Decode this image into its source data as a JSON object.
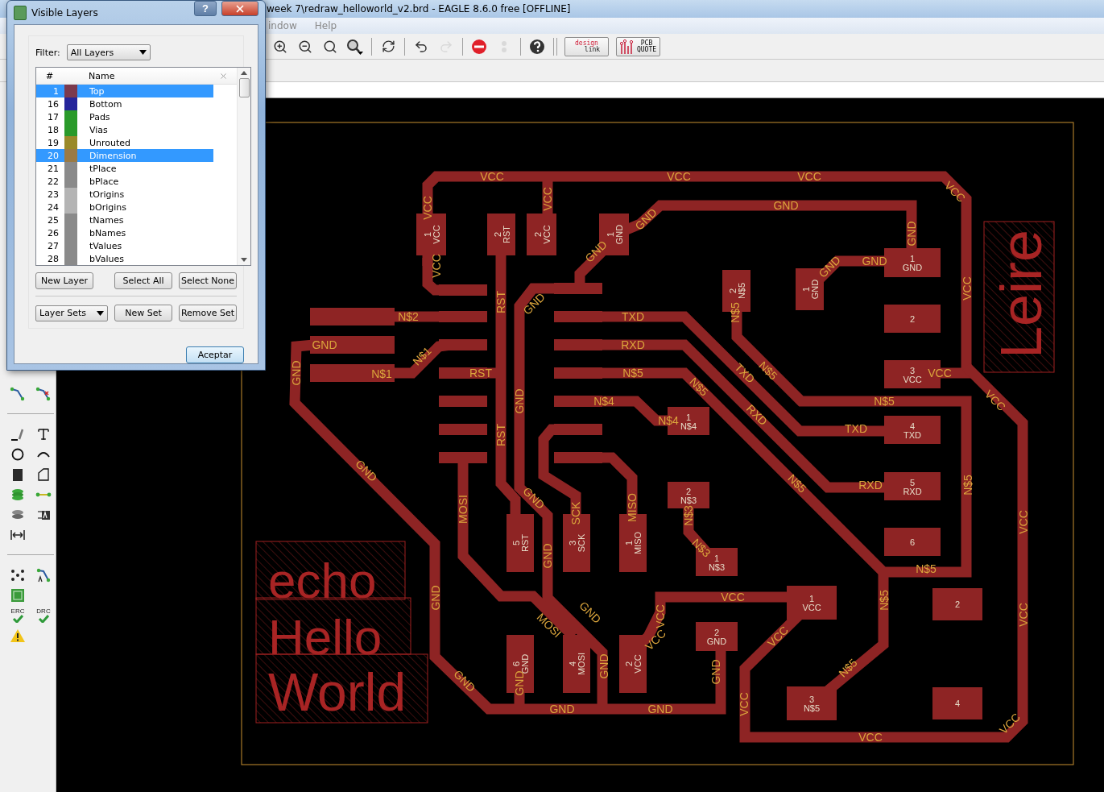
{
  "main_window": {
    "title": "week 7\\redraw_helloworld_v2.brd - EAGLE 8.6.0 free [OFFLINE]",
    "menu": [
      "indow",
      "Help"
    ],
    "toolbar": [
      {
        "kind": "zoom-in",
        "disabled": false
      },
      {
        "kind": "zoom-out",
        "disabled": false
      },
      {
        "kind": "zoom-fit",
        "disabled": false
      },
      {
        "kind": "zoom-select",
        "disabled": false
      },
      {
        "kind": "sep"
      },
      {
        "kind": "redraw",
        "disabled": false
      },
      {
        "kind": "sep"
      },
      {
        "kind": "undo",
        "disabled": false
      },
      {
        "kind": "redo",
        "disabled": true
      },
      {
        "kind": "sep"
      },
      {
        "kind": "stop",
        "disabled": false
      },
      {
        "kind": "go",
        "disabled": true
      },
      {
        "kind": "sep"
      },
      {
        "kind": "help",
        "disabled": false
      }
    ],
    "design_link": [
      "design",
      "link"
    ],
    "pcb_quote": [
      "PCB",
      "QUOTE"
    ]
  },
  "left_toolbar": {
    "erc": "ERC",
    "drc": "DRC"
  },
  "dialog": {
    "title": "Visible Layers",
    "help": "?",
    "filter_label": "Filter:",
    "filter_value": "All Layers",
    "columns": [
      "#",
      "Name"
    ],
    "layers": [
      {
        "number": "1",
        "name": "Top",
        "color": "#7b3a4e",
        "selected": true
      },
      {
        "number": "16",
        "name": "Bottom",
        "color": "#25259a",
        "selected": false
      },
      {
        "number": "17",
        "name": "Pads",
        "color": "#2a9a2a",
        "selected": false
      },
      {
        "number": "18",
        "name": "Vias",
        "color": "#2a9a2a",
        "selected": false
      },
      {
        "number": "19",
        "name": "Unrouted",
        "color": "#9a8a2a",
        "selected": false
      },
      {
        "number": "20",
        "name": "Dimension",
        "color": "#9a7a45",
        "selected": true
      },
      {
        "number": "21",
        "name": "tPlace",
        "color": "#8a8a8a",
        "selected": false
      },
      {
        "number": "22",
        "name": "bPlace",
        "color": "#8a8a8a",
        "selected": false
      },
      {
        "number": "23",
        "name": "tOrigins",
        "color": "#b4b4b4",
        "selected": false
      },
      {
        "number": "24",
        "name": "bOrigins",
        "color": "#b4b4b4",
        "selected": false
      },
      {
        "number": "25",
        "name": "tNames",
        "color": "#8a8a8a",
        "selected": false
      },
      {
        "number": "26",
        "name": "bNames",
        "color": "#8a8a8a",
        "selected": false
      },
      {
        "number": "27",
        "name": "tValues",
        "color": "#8a8a8a",
        "selected": false
      },
      {
        "number": "28",
        "name": "bValues",
        "color": "#8a8a8a",
        "selected": false
      }
    ],
    "buttons_top": [
      "New Layer",
      "Select All",
      "Select None"
    ],
    "sets_dropdown": "Layer Sets",
    "buttons_bottom": [
      "New Set",
      "Remove Set"
    ],
    "ok_button": "Aceptar"
  },
  "board": {
    "net_labels": [
      "VCC",
      "VCC",
      "VCC",
      "VCC",
      "VCC",
      "VCC",
      "GND",
      "GND",
      "GND",
      "GND",
      "GND",
      "GND",
      "VCC",
      "N$5",
      "VCC",
      "N$2",
      "GND",
      "N$1",
      "N$1",
      "GND",
      "RST",
      "RST",
      "GND",
      "TXD",
      "RXD",
      "N$5",
      "N$4",
      "N$4",
      "GND",
      "RST",
      "TXD",
      "N$5",
      "N$5",
      "RXD",
      "N$5",
      "TXD",
      "VCC",
      "VCC",
      "RXD",
      "N$5",
      "N$5",
      "VCC",
      "GND",
      "MOSI",
      "GND",
      "SCK",
      "MISO",
      "N$3",
      "N$3",
      "GND",
      "N$5",
      "N$5",
      "GND",
      "MOSI",
      "GND",
      "VCC",
      "VCC",
      "VCC",
      "VCC",
      "N$5",
      "VCC",
      "GND",
      "GND",
      "GND",
      "GND",
      "GND",
      "GND",
      "VCC",
      "VCC",
      "VCC"
    ],
    "pads": [
      {
        "number": "1",
        "name": "VCC"
      },
      {
        "number": "2",
        "name": "RST"
      },
      {
        "number": "2",
        "name": "VCC"
      },
      {
        "number": "1",
        "name": "GND"
      },
      {
        "number": "2",
        "name": "N$5"
      },
      {
        "number": "1",
        "name": "GND"
      },
      {
        "number": "1",
        "name": "GND"
      },
      {
        "number": "2"
      },
      {
        "number": "3",
        "name": "VCC"
      },
      {
        "number": "4",
        "name": "TXD"
      },
      {
        "number": "5",
        "name": "RXD"
      },
      {
        "number": "6"
      },
      {
        "number": "1",
        "name": "N$4"
      },
      {
        "number": "2",
        "name": "N$3"
      },
      {
        "number": "1",
        "name": "N$3"
      },
      {
        "number": "5",
        "name": "RST"
      },
      {
        "number": "3",
        "name": "SCK"
      },
      {
        "number": "1",
        "name": "MISO"
      },
      {
        "number": "6",
        "name": "GND"
      },
      {
        "number": "4",
        "name": "MOSI"
      },
      {
        "number": "2",
        "name": "VCC"
      },
      {
        "number": "2",
        "name": "GND"
      },
      {
        "number": "1",
        "name": "VCC"
      },
      {
        "number": "3",
        "name": "N$5"
      },
      {
        "number": "2"
      },
      {
        "number": "4"
      }
    ],
    "silkscreen": [
      "Leire",
      "echo",
      "Hello",
      "World"
    ]
  }
}
